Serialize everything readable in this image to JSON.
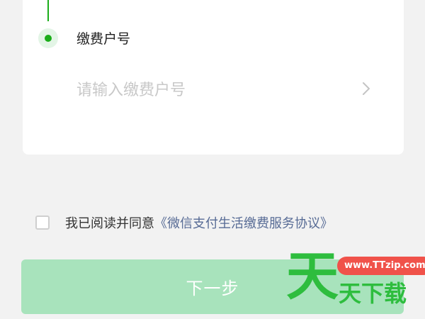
{
  "form": {
    "account_label": "缴费户号",
    "account_placeholder": "请输入缴费户号",
    "chevron_icon": "chevron-right-icon"
  },
  "agreement": {
    "prefix": "我已阅读并同意",
    "link": "《微信支付生活缴费服务协议》",
    "checked": false
  },
  "next_button": {
    "label": "下一步",
    "enabled": false
  },
  "watermark": {
    "big_char": "天",
    "url": "www.TTzip.com",
    "text": "天下载"
  },
  "colors": {
    "accent": "#1aad19",
    "button_disabled": "#a8e3bc",
    "link": "#576b95",
    "background": "#f2f2f2"
  }
}
